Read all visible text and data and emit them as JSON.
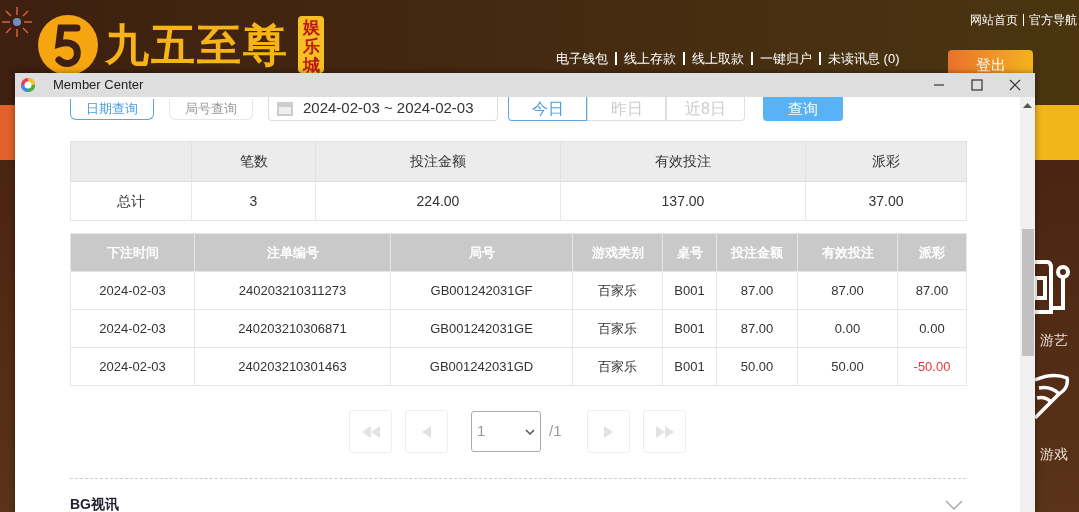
{
  "site": {
    "logo_text": "九五至尊",
    "logo_badge": "娱乐城",
    "top_links": [
      "网站首页",
      "官方导航"
    ],
    "nav_links": [
      "电子钱包",
      "线上存款",
      "线上取款",
      "一键归户",
      "未读讯息 (0)"
    ],
    "logout": "登出",
    "side_items": [
      {
        "label": "游艺",
        "kind": "slot"
      },
      {
        "label": "游戏",
        "kind": "shell"
      }
    ]
  },
  "window": {
    "title": "Member Center"
  },
  "query_tabs": [
    {
      "label": "日期查询",
      "selected": true
    },
    {
      "label": "局号查询",
      "selected": false
    }
  ],
  "date_range": "2024-02-03 ~ 2024-02-03",
  "quick_dates": [
    {
      "label": "今日",
      "selected": true
    },
    {
      "label": "昨日",
      "selected": false
    },
    {
      "label": "近8日",
      "selected": false
    }
  ],
  "search_button": "查询",
  "summary": {
    "columns": [
      "",
      "笔数",
      "投注金额",
      "有效投注",
      "派彩"
    ],
    "rows": [
      [
        "总计",
        "3",
        "224.00",
        "137.00",
        "37.00"
      ]
    ]
  },
  "bets": {
    "columns": [
      "下注时间",
      "注单编号",
      "局号",
      "游戏类别",
      "桌号",
      "投注金额",
      "有效投注",
      "派彩"
    ],
    "rows": [
      {
        "cells": [
          "2024-02-03",
          "240203210311273",
          "GB001242031GF",
          "百家乐",
          "B001",
          "87.00",
          "87.00",
          "87.00"
        ],
        "loss": false
      },
      {
        "cells": [
          "2024-02-03",
          "240203210306871",
          "GB001242031GE",
          "百家乐",
          "B001",
          "87.00",
          "0.00",
          "0.00"
        ],
        "loss": false
      },
      {
        "cells": [
          "2024-02-03",
          "240203210301463",
          "GB001242031GD",
          "百家乐",
          "B001",
          "50.00",
          "50.00",
          "-50.00"
        ],
        "loss": true
      }
    ]
  },
  "pagination": {
    "page": "1",
    "total": "/1"
  },
  "section": {
    "title": "BG视讯",
    "expanded": false
  }
}
